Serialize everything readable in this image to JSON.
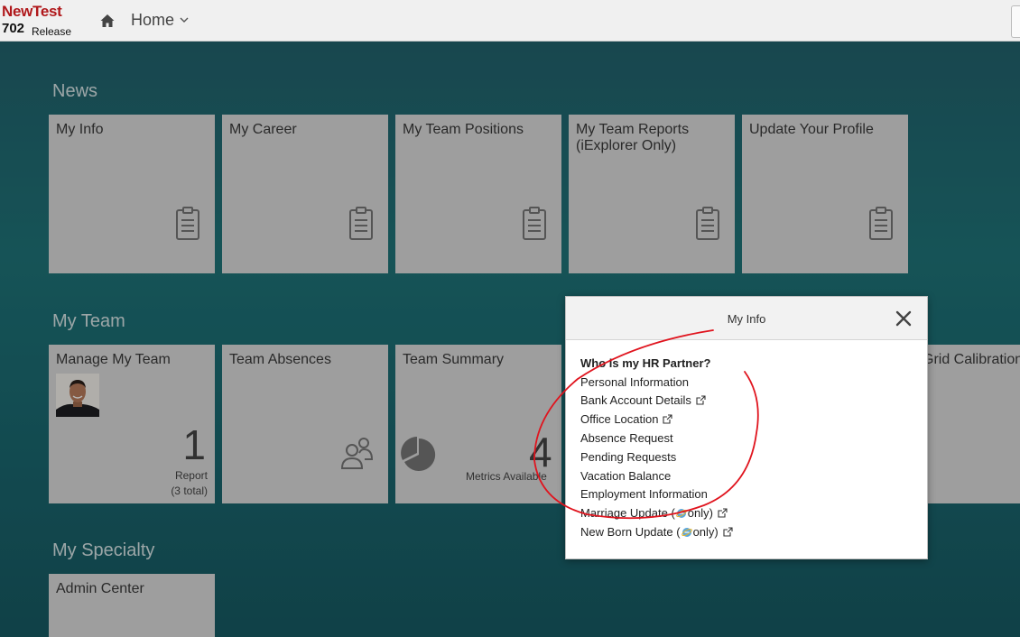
{
  "header": {
    "logo_line1": "NewTest",
    "logo_line2": "702",
    "logo_line3": "Release",
    "home_label": "Home"
  },
  "sections": {
    "news": "News",
    "my_team": "My Team",
    "my_specialty": "My Specialty"
  },
  "news_tiles": [
    {
      "title": "My Info"
    },
    {
      "title": "My Career"
    },
    {
      "title": "My Team Positions"
    },
    {
      "title": "My Team Reports (iExplorer Only)"
    },
    {
      "title": "Update Your Profile"
    }
  ],
  "team_tiles": {
    "manage": {
      "title": "Manage My Team",
      "count": "1",
      "sub1": "Report",
      "sub2": "(3 total)"
    },
    "absences": {
      "title": "Team Absences"
    },
    "summary": {
      "title": "Team Summary",
      "count": "4",
      "sub": "Metrics Available"
    },
    "grid": {
      "title": "Grid Calibration"
    }
  },
  "specialty_tiles": [
    {
      "title": "Admin Center"
    }
  ],
  "dialog": {
    "title": "My Info",
    "items": [
      {
        "label": "Who is my HR Partner?"
      },
      {
        "label": "Personal Information"
      },
      {
        "label": "Bank Account Details"
      },
      {
        "label": "Office Location"
      },
      {
        "label": "Absence Request"
      },
      {
        "label": "Pending Requests"
      },
      {
        "label": "Vacation Balance"
      },
      {
        "label": "Employment Information"
      },
      {
        "label_pre": "Marriage Update (",
        "label_post": "only)"
      },
      {
        "label_pre": "New Born Update (",
        "label_post": "only)"
      }
    ]
  },
  "colors": {
    "brand_red": "#b0181b",
    "annotation_red": "#e0141e",
    "tile_bg": "#dcdcdc",
    "background_teal": "#1f7479"
  },
  "icons": {
    "home": "home-icon",
    "close": "close-icon",
    "tile": "clipboard-icon",
    "external": "external-link-icon",
    "browser": "ie-browser-icon"
  }
}
